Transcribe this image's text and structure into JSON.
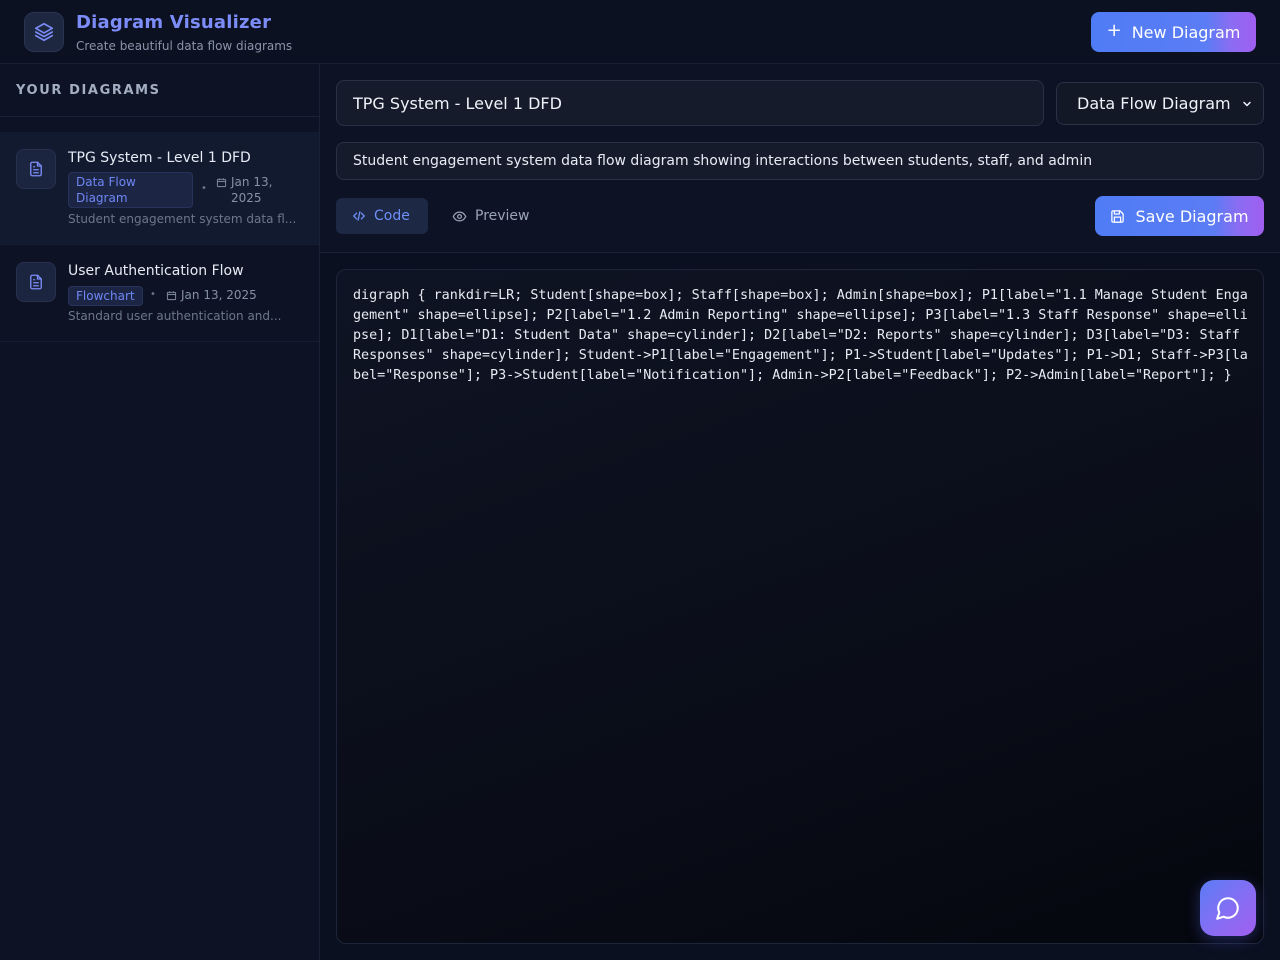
{
  "header": {
    "title": "Diagram Visualizer",
    "subtitle": "Create beautiful data flow diagrams",
    "new_button_label": "New Diagram",
    "logo_icon": "layers-icon"
  },
  "sidebar": {
    "heading": "YOUR DIAGRAMS",
    "items": [
      {
        "title": "TPG System - Level 1 DFD",
        "type_badge": "Data Flow\nDiagram",
        "date": "Jan 13,\n2025",
        "description": "Student engagement system data fl...",
        "active": true
      },
      {
        "title": "User Authentication Flow",
        "type_badge": "Flowchart",
        "date": "Jan 13, 2025",
        "description": "Standard user authentication and...",
        "active": false
      }
    ]
  },
  "editor": {
    "title_value": "TPG System - Level 1 DFD",
    "type_selected": "Data Flow Diagram",
    "description_value": "Student engagement system data flow diagram showing interactions between students, staff, and admin",
    "tabs": [
      {
        "label": "Code",
        "icon": "code-icon",
        "active": true
      },
      {
        "label": "Preview",
        "icon": "eye-icon",
        "active": false
      }
    ],
    "save_label": "Save Diagram",
    "code": "digraph { rankdir=LR; Student[shape=box]; Staff[shape=box]; Admin[shape=box]; P1[label=\"1.1 Manage Student Engagement\" shape=ellipse]; P2[label=\"1.2 Admin Reporting\" shape=ellipse]; P3[label=\"1.3 Staff Response\" shape=ellipse]; D1[label=\"D1: Student Data\" shape=cylinder]; D2[label=\"D2: Reports\" shape=cylinder]; D3[label=\"D3: Staff Responses\" shape=cylinder]; Student->P1[label=\"Engagement\"]; P1->Student[label=\"Updates\"]; P1->D1; Staff->P3[label=\"Response\"]; P3->Student[label=\"Notification\"]; Admin->P2[label=\"Feedback\"]; P2->Admin[label=\"Report\"]; }"
  },
  "colors": {
    "accent": "#5b7cf5",
    "accent_gradient_end": "#a05ef0",
    "background": "#0b0f1c"
  }
}
